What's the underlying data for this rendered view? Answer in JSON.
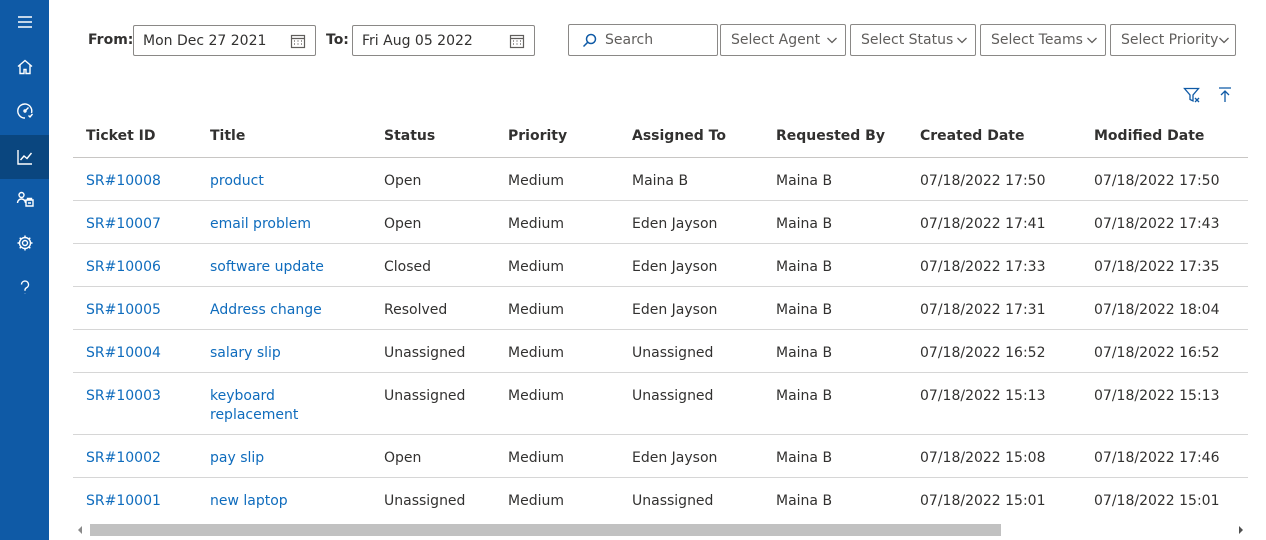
{
  "sidebar": {
    "items": [
      {
        "icon": "menu-icon"
      },
      {
        "icon": "home-icon"
      },
      {
        "icon": "dashboard-icon"
      },
      {
        "icon": "analytics-icon",
        "active": true
      },
      {
        "icon": "agents-icon"
      },
      {
        "icon": "settings-icon"
      },
      {
        "icon": "help-icon"
      }
    ],
    "bg_color": "#0f5aa6",
    "active_color": "#0a467f"
  },
  "filters": {
    "from_label": "From:",
    "from_value": "Mon Dec 27 2021",
    "to_label": "To:",
    "to_value": "Fri Aug 05 2022",
    "search_placeholder": "Search",
    "agent": "Select Agent",
    "status": "Select Status",
    "teams": "Select Teams",
    "priority": "Select Priority"
  },
  "toolbar": {
    "clear_filter_icon": "filter-clear-icon",
    "export_icon": "arrow-up-to-line-icon"
  },
  "table": {
    "columns": [
      "Ticket ID",
      "Title",
      "Status",
      "Priority",
      "Assigned To",
      "Requested By",
      "Created Date",
      "Modified Date"
    ],
    "rows": [
      {
        "id": "SR#10008",
        "title": "product",
        "status": "Open",
        "priority": "Medium",
        "assigned": "Maina B",
        "requested": "Maina B",
        "created": "07/18/2022 17:50",
        "modified": "07/18/2022 17:50"
      },
      {
        "id": "SR#10007",
        "title": "email problem",
        "status": "Open",
        "priority": "Medium",
        "assigned": "Eden Jayson",
        "requested": "Maina B",
        "created": "07/18/2022 17:41",
        "modified": "07/18/2022 17:43"
      },
      {
        "id": "SR#10006",
        "title": "software update",
        "status": "Closed",
        "priority": "Medium",
        "assigned": "Eden Jayson",
        "requested": "Maina B",
        "created": "07/18/2022 17:33",
        "modified": "07/18/2022 17:35"
      },
      {
        "id": "SR#10005",
        "title": "Address change",
        "status": "Resolved",
        "priority": "Medium",
        "assigned": "Eden Jayson",
        "requested": "Maina B",
        "created": "07/18/2022 17:31",
        "modified": "07/18/2022 18:04"
      },
      {
        "id": "SR#10004",
        "title": "salary slip",
        "status": "Unassigned",
        "priority": "Medium",
        "assigned": "Unassigned",
        "requested": "Maina B",
        "created": "07/18/2022 16:52",
        "modified": "07/18/2022 16:52"
      },
      {
        "id": "SR#10003",
        "title": "keyboard replacement",
        "status": "Unassigned",
        "priority": "Medium",
        "assigned": "Unassigned",
        "requested": "Maina B",
        "created": "07/18/2022 15:13",
        "modified": "07/18/2022 15:13"
      },
      {
        "id": "SR#10002",
        "title": "pay slip",
        "status": "Open",
        "priority": "Medium",
        "assigned": "Eden Jayson",
        "requested": "Maina B",
        "created": "07/18/2022 15:08",
        "modified": "07/18/2022 17:46"
      },
      {
        "id": "SR#10001",
        "title": "new laptop",
        "status": "Unassigned",
        "priority": "Medium",
        "assigned": "Unassigned",
        "requested": "Maina B",
        "created": "07/18/2022 15:01",
        "modified": "07/18/2022 15:01"
      }
    ]
  },
  "colors": {
    "link": "#0f6cbd",
    "accent": "#0f5aa6"
  }
}
